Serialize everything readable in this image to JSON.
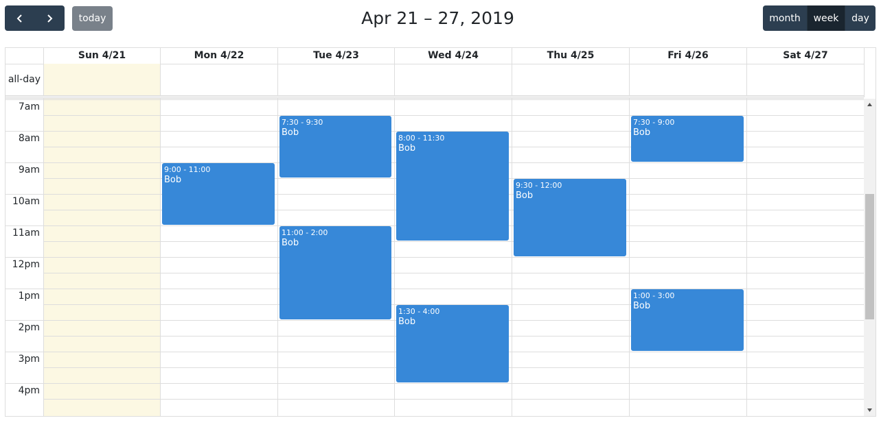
{
  "toolbar": {
    "prev_icon": "chevron-left-icon",
    "next_icon": "chevron-right-icon",
    "today_label": "today",
    "title": "Apr 21 – 27, 2019",
    "views": [
      {
        "label": "month",
        "active": false
      },
      {
        "label": "week",
        "active": true
      },
      {
        "label": "day",
        "active": false
      }
    ]
  },
  "calendar": {
    "all_day_label": "all-day",
    "today_column": 0,
    "days": [
      {
        "header": "Sun 4/21"
      },
      {
        "header": "Mon 4/22"
      },
      {
        "header": "Tue 4/23"
      },
      {
        "header": "Wed 4/24"
      },
      {
        "header": "Thu 4/25"
      },
      {
        "header": "Fri 4/26"
      },
      {
        "header": "Sat 4/27"
      }
    ],
    "hours": [
      "7am",
      "8am",
      "9am",
      "10am",
      "11am",
      "12pm",
      "1pm",
      "2pm",
      "3pm",
      "4pm"
    ],
    "events": [
      {
        "day": 1,
        "start": 9.0,
        "end": 11.0,
        "time": "9:00 - 11:00",
        "title": "Bob"
      },
      {
        "day": 2,
        "start": 7.5,
        "end": 9.5,
        "time": "7:30 - 9:30",
        "title": "Bob"
      },
      {
        "day": 2,
        "start": 11.0,
        "end": 14.0,
        "time": "11:00 - 2:00",
        "title": "Bob"
      },
      {
        "day": 3,
        "start": 8.0,
        "end": 11.5,
        "time": "8:00 - 11:30",
        "title": "Bob"
      },
      {
        "day": 3,
        "start": 13.5,
        "end": 16.0,
        "time": "1:30 - 4:00",
        "title": "Bob"
      },
      {
        "day": 4,
        "start": 9.5,
        "end": 12.0,
        "time": "9:30 - 12:00",
        "title": "Bob"
      },
      {
        "day": 5,
        "start": 7.5,
        "end": 9.0,
        "time": "7:30 - 9:00",
        "title": "Bob"
      },
      {
        "day": 5,
        "start": 13.0,
        "end": 15.0,
        "time": "1:00 - 3:00",
        "title": "Bob"
      }
    ],
    "colors": {
      "event": "#3788d8",
      "today_bg": "#fcf8e3",
      "toolbar_button": "#2c3e50",
      "toolbar_button_active": "#1a252f",
      "today_button": "#79818a"
    }
  }
}
